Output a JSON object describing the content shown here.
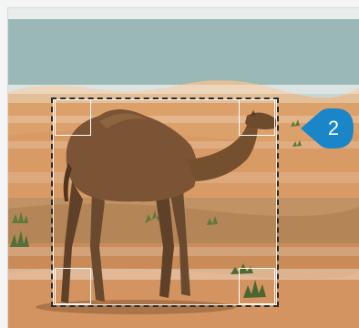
{
  "badge": {
    "label": "2",
    "color": "#1a86c8"
  },
  "scene": {
    "sky_color": "#9ab8b6",
    "sand_color": "#d9a06a",
    "camel_color": "#7a5434"
  },
  "icons": {
    "selection": "crop-selection-icon",
    "callout": "step-callout-icon"
  }
}
